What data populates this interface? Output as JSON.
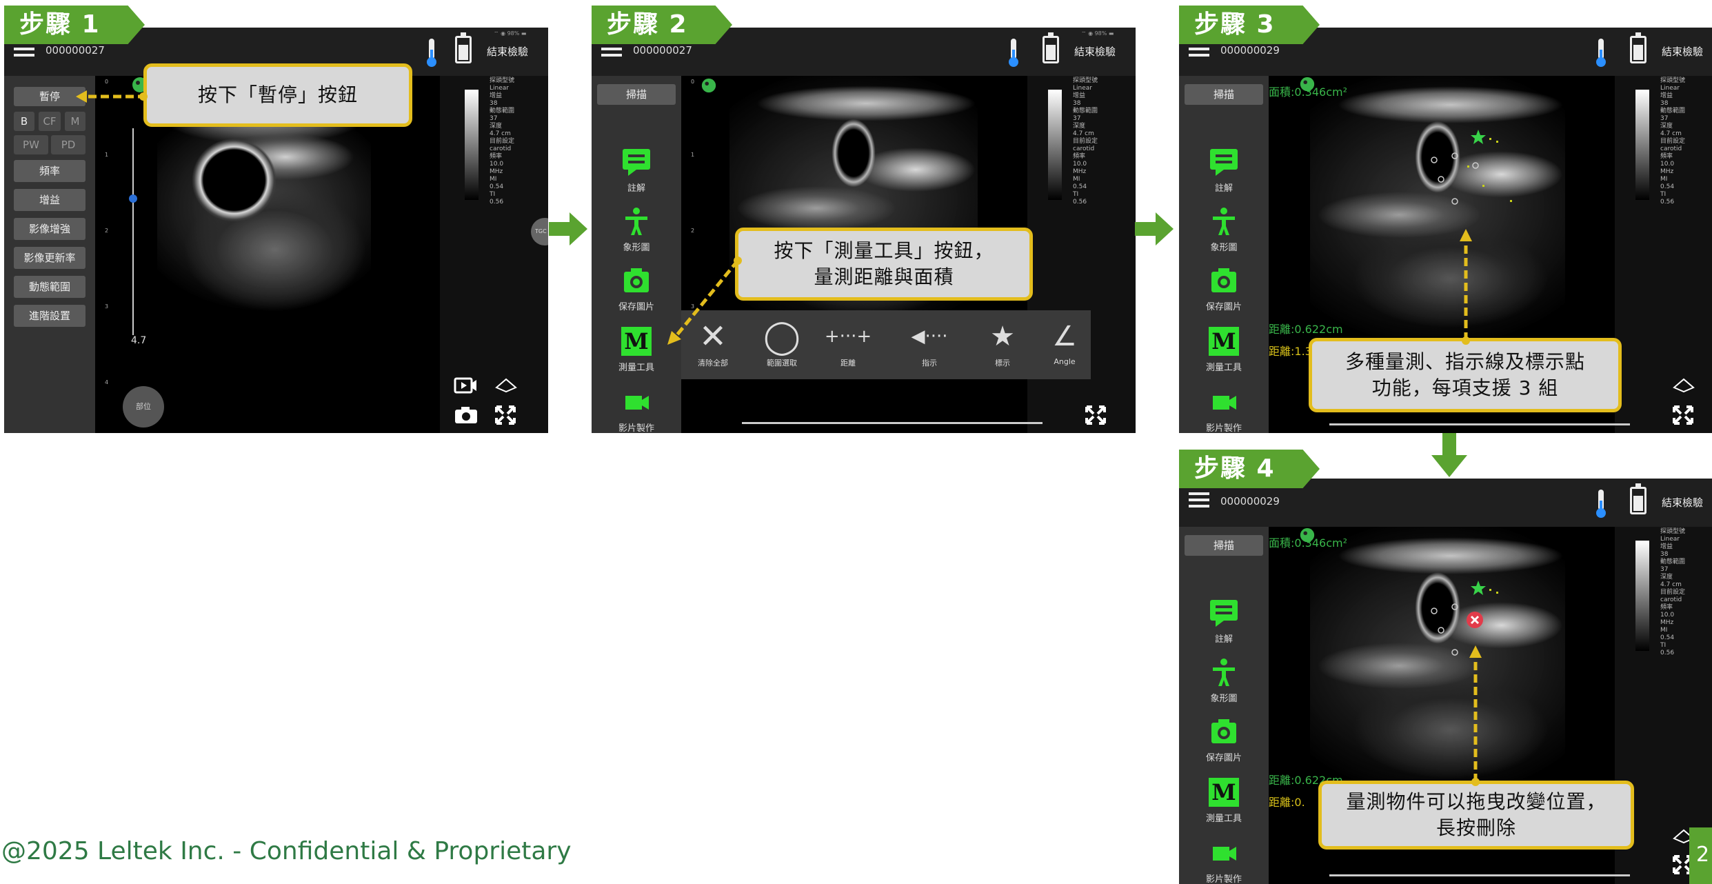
{
  "steps": [
    {
      "label": "步驟 1"
    },
    {
      "label": "步驟 2"
    },
    {
      "label": "步驟 3"
    },
    {
      "label": "步驟 4"
    }
  ],
  "topbar": {
    "patient_id_1": "000000027",
    "patient_id_2": "000000027",
    "patient_id_3": "000000029",
    "patient_id_4": "000000029",
    "end_exam": "結束檢驗",
    "status": "⌔ ◉ 98% ▬"
  },
  "step1": {
    "sidebar": {
      "pause": "暫停",
      "mode_b": "B",
      "mode_cf": "CF",
      "mode_m": "M",
      "mode_pw": "PW",
      "mode_pd": "PD",
      "frequency": "頻率",
      "gain": "增益",
      "image_enhance": "影像增強",
      "frame_rate": "影像更新率",
      "dynamic_range": "動態範圍",
      "advanced": "進階設置"
    },
    "depth_value": "4.7",
    "position_button": "部位",
    "toggle_label": "TGC",
    "callout": "按下「暫停」按鈕"
  },
  "tools": {
    "scan": "掃描",
    "annotation": "註解",
    "body_marker": "象形圖",
    "save_image": "保存圖片",
    "measure": "測量工具",
    "clip": "影片製作",
    "measure_letter": "M"
  },
  "step2": {
    "callout_line1": "按下「測量工具」按鈕，",
    "callout_line2": "量測距離與面積",
    "measure_toolbar": [
      {
        "glyph": "✕",
        "label": "清除全部"
      },
      {
        "glyph": "◯",
        "label": "範圍選取"
      },
      {
        "glyph": "+···+",
        "label": "距離"
      },
      {
        "glyph": "◀····",
        "label": "指示"
      },
      {
        "glyph": "★",
        "label": "標示"
      },
      {
        "glyph": "∠",
        "label": "Angle"
      }
    ]
  },
  "step3": {
    "area_text": "面積:0.346cm²",
    "distance1": "距離:0.622cm",
    "distance2": "距離:1.352cm",
    "callout_line1": "多種量測、指示線及標示點",
    "callout_line2": "功能，每項支援 3 組"
  },
  "step4": {
    "area_text": "面積:0.346cm²",
    "distance1": "距離:0.622cm",
    "distance2": "距離:0.",
    "callout_line1": "量測物件可以拖曳改變位置，",
    "callout_line2": "長按刪除"
  },
  "info_column": "探頭型號\nLinear\n增益\n38\n動態範圍\n37\n深度\n4.7 cm\n目前設定\ncarotid\n頻率\n10.0\nMHz\nMI\n0.54\nTI\n0.56",
  "depth_ticks": [
    "0",
    "1",
    "2",
    "3",
    "4"
  ],
  "footer": "@2025 Leltek Inc. - Confidential & Proprietary",
  "page_number": "2",
  "colors": {
    "step_green": "#5aa330",
    "callout_border": "#e3bd1d",
    "measure_green": "#39b54a",
    "footer_text": "#2f7a45"
  }
}
